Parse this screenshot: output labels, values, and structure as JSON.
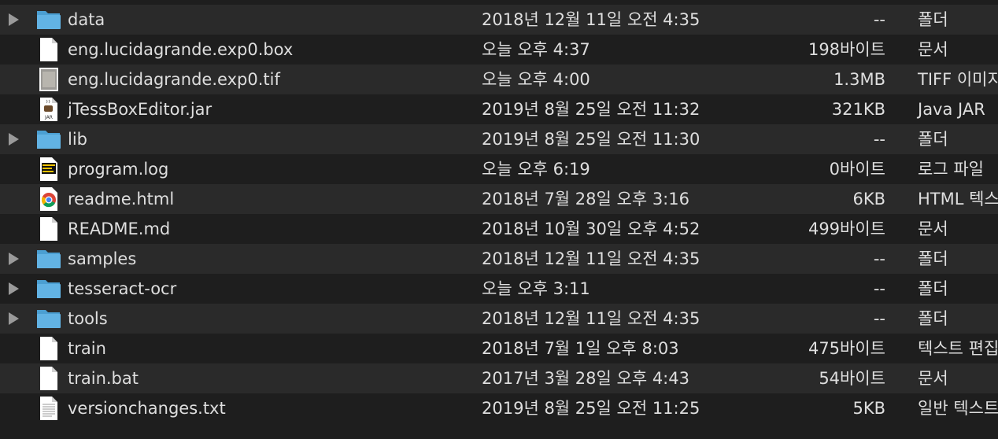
{
  "rows": [
    {
      "name": "data",
      "date": "2018년 12월 11일 오전 4:35",
      "size": "--",
      "kind": "폴더",
      "icon": "folder-icon",
      "folder": true
    },
    {
      "name": "eng.lucidagrande.exp0.box",
      "date": "오늘 오후 4:37",
      "size": "198바이트",
      "kind": "문서",
      "icon": "document-icon",
      "folder": false
    },
    {
      "name": "eng.lucidagrande.exp0.tif",
      "date": "오늘 오후 4:00",
      "size": "1.3MB",
      "kind": "TIFF 이미지",
      "icon": "image-thumbnail-icon",
      "folder": false
    },
    {
      "name": "jTessBoxEditor.jar",
      "date": "2019년 8월 25일 오전 11:32",
      "size": "321KB",
      "kind": "Java JAR",
      "icon": "jar-file-icon",
      "folder": false
    },
    {
      "name": "lib",
      "date": "2019년 8월 25일 오전 11:30",
      "size": "--",
      "kind": "폴더",
      "icon": "folder-icon",
      "folder": true
    },
    {
      "name": "program.log",
      "date": "오늘 오후 6:19",
      "size": "0바이트",
      "kind": "로그 파일",
      "icon": "log-file-icon",
      "folder": false
    },
    {
      "name": "readme.html",
      "date": "2018년 7월 28일 오후 3:16",
      "size": "6KB",
      "kind": "HTML 텍스트",
      "icon": "chrome-icon",
      "folder": false
    },
    {
      "name": "README.md",
      "date": "2018년 10월 30일 오후 4:52",
      "size": "499바이트",
      "kind": "문서",
      "icon": "document-icon",
      "folder": false
    },
    {
      "name": "samples",
      "date": "2018년 12월 11일 오전 4:35",
      "size": "--",
      "kind": "폴더",
      "icon": "folder-icon",
      "folder": true
    },
    {
      "name": "tesseract-ocr",
      "date": "오늘 오후 3:11",
      "size": "--",
      "kind": "폴더",
      "icon": "folder-icon",
      "folder": true
    },
    {
      "name": "tools",
      "date": "2018년 12월 11일 오전 4:35",
      "size": "--",
      "kind": "폴더",
      "icon": "folder-icon",
      "folder": true
    },
    {
      "name": "train",
      "date": "2018년 7월 1일 오후 8:03",
      "size": "475바이트",
      "kind": "텍스트 편집",
      "icon": "document-icon",
      "folder": false
    },
    {
      "name": "train.bat",
      "date": "2017년 3월 28일 오후 4:43",
      "size": "54바이트",
      "kind": "문서",
      "icon": "document-icon",
      "folder": false
    },
    {
      "name": "versionchanges.txt",
      "date": "2019년 8월 25일 오전 11:25",
      "size": "5KB",
      "kind": "일반 텍스트",
      "icon": "text-file-icon",
      "folder": false
    }
  ],
  "colors": {
    "folder": "#5aaedf",
    "row_odd": "#2a2a2a",
    "row_even": "#1e1e1e",
    "text": "#dedede"
  }
}
